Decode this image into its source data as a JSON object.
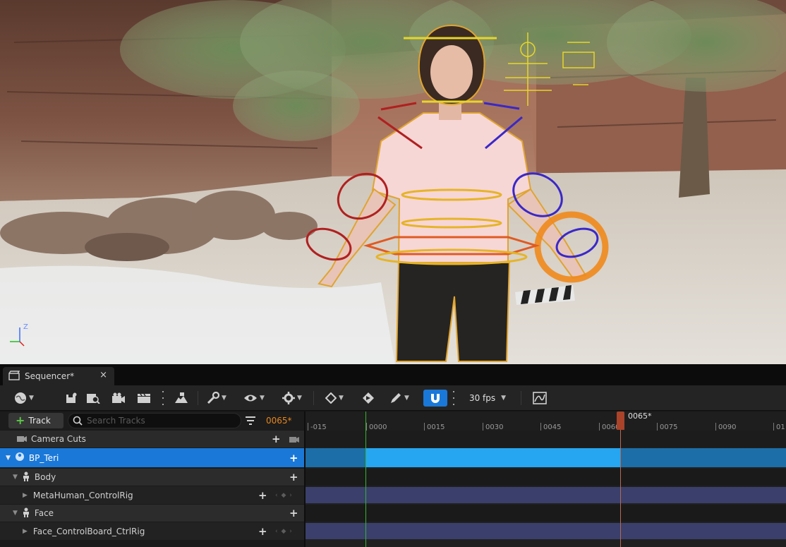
{
  "sequencer": {
    "tab_title": "Sequencer*",
    "tab_close": "×"
  },
  "toolbar": {
    "fps_label": "30 fps",
    "icons": [
      "world-icon",
      "save-icon",
      "find-icon",
      "camera-icon",
      "clapper-icon",
      "render-icon",
      "wrench-icon",
      "eye-icon",
      "gear-icon",
      "key-diamond-icon",
      "autokey-icon",
      "pencil-icon",
      "magnet-icon",
      "curve-editor-icon"
    ]
  },
  "outliner": {
    "add_track_label": "Track",
    "search_placeholder": "Search Tracks",
    "current_frame": "0065*",
    "rows": [
      {
        "label": "Camera Cuts"
      },
      {
        "label": "BP_Teri"
      },
      {
        "label": "Body"
      },
      {
        "label": "MetaHuman_ControlRig"
      },
      {
        "label": "Face"
      },
      {
        "label": "Face_ControlBoard_CtrlRig"
      }
    ],
    "key_nav": "‹ ◆ ›"
  },
  "timeline": {
    "ticks": [
      "-015",
      "0000",
      "0015",
      "0030",
      "0045",
      "0060",
      "0075",
      "0090",
      "01"
    ],
    "playhead_label": "0065*",
    "playhead_frame": 65,
    "start_frame": 0
  },
  "viewport": {
    "axis_z": "Z"
  },
  "colors": {
    "selection": "#1a78d8",
    "section_active": "#26a6f0",
    "controlrig_section": "#3b3f6b",
    "playhead": "#a9432a",
    "frame_readout": "#e6861c"
  }
}
